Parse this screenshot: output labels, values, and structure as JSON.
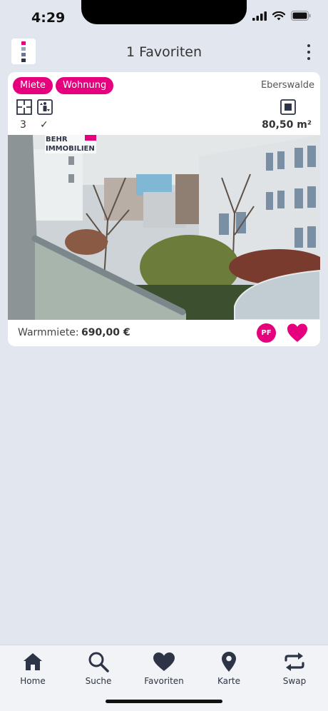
{
  "status_bar": {
    "time": "4:29",
    "icons": [
      "signal-icon",
      "wifi-icon",
      "battery-icon"
    ]
  },
  "header": {
    "title": "1 Favoriten",
    "logo": "brand-logo-icon",
    "menu": "more-vertical-icon"
  },
  "listing": {
    "tags": [
      "Miete",
      "Wohnung"
    ],
    "city": "Eberswalde",
    "features": [
      {
        "icon": "floorplan-icon",
        "value": "3"
      },
      {
        "icon": "elevator-icon",
        "value": "✓"
      }
    ],
    "area_icon": "square-icon",
    "area": "80,50 m²",
    "photo_watermark": "BEHR IMMOBILIEN",
    "price_label": "Warmmiete:",
    "price": "690,00 €",
    "badge": "PF",
    "favorite_icon": "heart-icon"
  },
  "tabbar": {
    "tabs": [
      {
        "label": "Home",
        "icon": "home-icon"
      },
      {
        "label": "Suche",
        "icon": "search-icon"
      },
      {
        "label": "Favoriten",
        "icon": "heart-icon"
      },
      {
        "label": "Karte",
        "icon": "map-pin-icon"
      },
      {
        "label": "Swap",
        "icon": "swap-icon"
      }
    ]
  },
  "colors": {
    "accent": "#e6007e",
    "background": "#e2e6ee",
    "icon_dark": "#2d3446"
  }
}
